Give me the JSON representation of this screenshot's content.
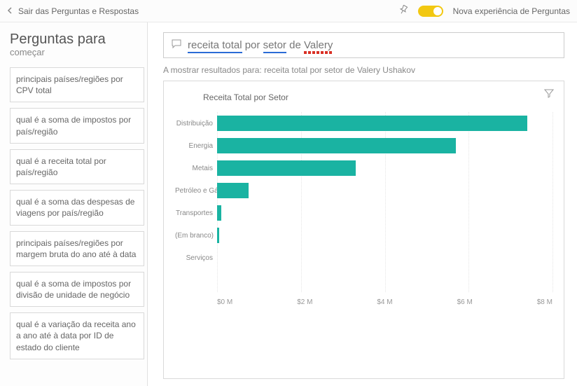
{
  "topbar": {
    "back_label": "Sair das Perguntas e Respostas",
    "toggle_label": "Nova experiência de Perguntas"
  },
  "sidebar": {
    "title": "Perguntas para",
    "subtitle": "começar",
    "questions": [
      "principais países/regiões por CPV total",
      "qual é a soma de impostos por país/região",
      "qual é a receita total por país/região",
      "qual é a soma das despesas de viagens por país/região",
      "principais países/regiões por margem bruta do ano até à data",
      "qual é a soma de impostos por divisão de unidade de negócio",
      "qual é a variação da receita ano a ano até à data por ID de estado do cliente"
    ]
  },
  "query": {
    "parts": [
      {
        "text": "receita total",
        "underline": "blue"
      },
      {
        "text": "por",
        "underline": ""
      },
      {
        "text": "setor",
        "underline": "blue"
      },
      {
        "text": "de",
        "underline": ""
      },
      {
        "text": "Valery",
        "underline": "red"
      }
    ],
    "showing_prefix": "A mostrar resultados para:",
    "showing_value": "receita total por setor de Valery Ushakov"
  },
  "chart_data": {
    "type": "bar",
    "orientation": "horizontal",
    "title": "Receita Total por Setor",
    "xlabel": "",
    "ylabel": "",
    "xlim": [
      0,
      8000000
    ],
    "ticks": [
      "$0 M",
      "$2 M",
      "$4 M",
      "$6 M",
      "$8 M"
    ],
    "categories": [
      "Distribuição",
      "Energia",
      "Metais",
      "Petróleo e Gás",
      "Transportes",
      "(Em branco)",
      "Serviços"
    ],
    "values": [
      7400000,
      5700000,
      3300000,
      750000,
      100000,
      50000,
      0
    ]
  }
}
